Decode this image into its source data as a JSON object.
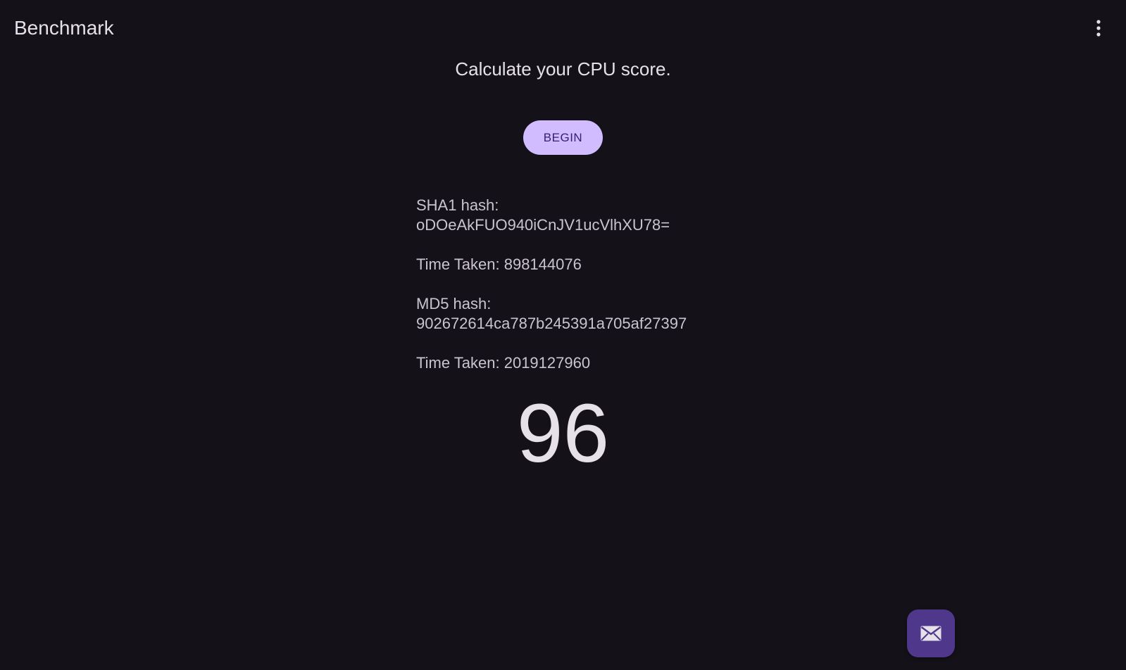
{
  "app_bar": {
    "title": "Benchmark",
    "menu_icon": "more-vert-icon"
  },
  "main": {
    "headline": "Calculate your CPU score.",
    "begin_label": "BEGIN",
    "sha1_label": "SHA1 hash:",
    "sha1_value": "oDOeAkFUO940iCnJV1ucVlhXU78=",
    "sha1_time": "Time Taken: 898144076",
    "md5_label": "MD5 hash:",
    "md5_value": "902672614ca787b245391a705af27397",
    "md5_time": "Time Taken: 2019127960",
    "score": "96"
  },
  "fab": {
    "icon": "email-icon"
  },
  "colors": {
    "background": "#141218",
    "primary_button": "#d0bcff",
    "fab": "#4f378b",
    "text": "#e6e0e9"
  }
}
